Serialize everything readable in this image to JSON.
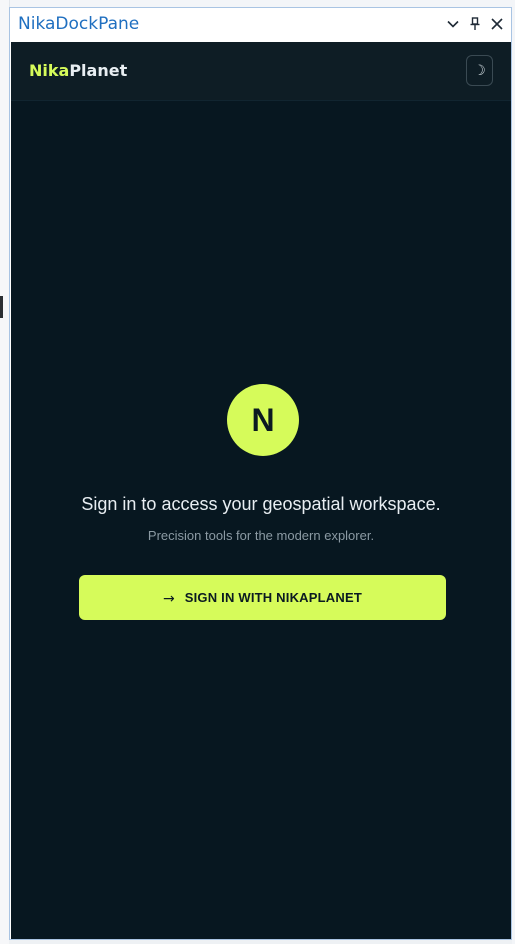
{
  "window": {
    "title": "NikaDockPane",
    "controls": {
      "dropdown_icon": "chevron-down-icon",
      "pin_icon": "pin-icon",
      "close_icon": "close-icon"
    }
  },
  "header": {
    "brand_part1": "Nika",
    "brand_part2": "Planet",
    "theme_toggle_glyph": "☽",
    "theme_toggle_icon": "moon-icon"
  },
  "main": {
    "logo_letter": "N",
    "headline": "Sign in to access your geospatial workspace.",
    "subline": "Precision tools for the modern explorer.",
    "signin_button": {
      "arrow": "→",
      "label": "SIGN IN WITH NIKAPLANET"
    }
  },
  "colors": {
    "accent": "#d6fb5a",
    "background": "#071720",
    "header_background": "#0e1d25",
    "pane_title": "#1f6fc0"
  }
}
